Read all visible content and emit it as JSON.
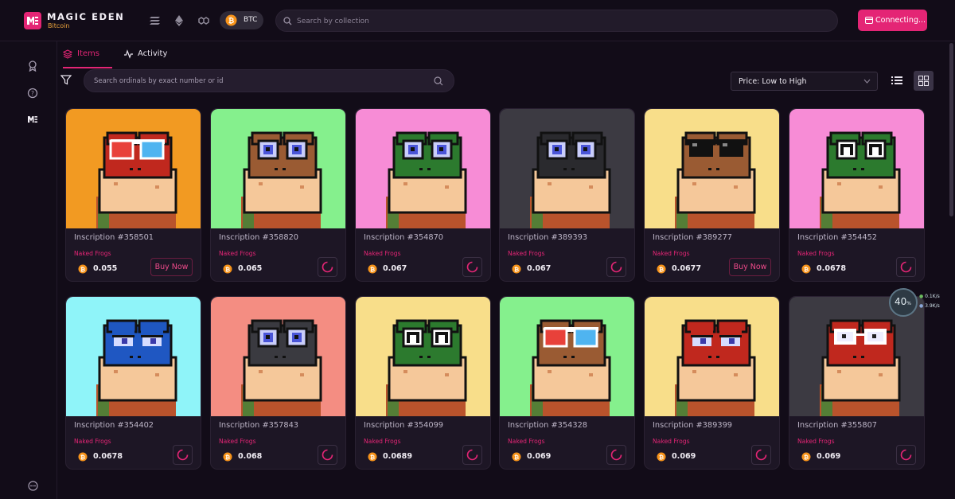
{
  "brand": {
    "name": "MAGIC EDEN",
    "sub": "Bitcoin"
  },
  "chain_pill": {
    "label": "BTC"
  },
  "top_search": {
    "placeholder": "Search by collection"
  },
  "connect_button": {
    "label": "Connecting..."
  },
  "tabs": [
    {
      "label": "Items"
    },
    {
      "label": "Activity"
    }
  ],
  "ordinal_search": {
    "placeholder": "Search ordinals by exact number or id"
  },
  "sort": {
    "selected": "Price: Low to High"
  },
  "colors": {
    "accent": "#e42575",
    "bg": "#120c18",
    "card": "#1d1625",
    "btc": "#f7931a"
  },
  "cards": [
    {
      "title": "Inscription #358501",
      "collection": "Naked Frogs",
      "price": "0.055",
      "action": "buy",
      "action_label": "Buy Now",
      "bg": "#f29a22",
      "skin": "#c0281e",
      "eyes": "3d-glasses"
    },
    {
      "title": "Inscription #358820",
      "collection": "Naked Frogs",
      "price": "0.065",
      "action": "loading",
      "bg": "#85f08d",
      "skin": "#9a5b33",
      "eyes": "normal"
    },
    {
      "title": "Inscription #354870",
      "collection": "Naked Frogs",
      "price": "0.067",
      "action": "loading",
      "bg": "#f78cd6",
      "skin": "#2c7a2e",
      "eyes": "normal"
    },
    {
      "title": "Inscription #389393",
      "collection": "Naked Frogs",
      "price": "0.067",
      "action": "loading",
      "bg": "#3c3a42",
      "skin": "#2a2a2e",
      "eyes": "normal"
    },
    {
      "title": "Inscription #389277",
      "collection": "Naked Frogs",
      "price": "0.0677",
      "action": "buy",
      "action_label": "Buy Now",
      "bg": "#f8de8a",
      "skin": "#9a5b33",
      "eyes": "shades"
    },
    {
      "title": "Inscription #354452",
      "collection": "Naked Frogs",
      "price": "0.0678",
      "action": "loading",
      "bg": "#f78cd6",
      "skin": "#2c7a2e",
      "eyes": "n"
    },
    {
      "title": "Inscription #354402",
      "collection": "Naked Frogs",
      "price": "0.0678",
      "action": "loading",
      "bg": "#8ff4f9",
      "skin": "#1f57c2",
      "eyes": "sleepy"
    },
    {
      "title": "Inscription #357843",
      "collection": "Naked Frogs",
      "price": "0.068",
      "action": "loading",
      "bg": "#f48d82",
      "skin": "#3a3a40",
      "eyes": "normal"
    },
    {
      "title": "Inscription #354099",
      "collection": "Naked Frogs",
      "price": "0.0689",
      "action": "loading",
      "bg": "#f8de8a",
      "skin": "#2c7a2e",
      "eyes": "n"
    },
    {
      "title": "Inscription #354328",
      "collection": "Naked Frogs",
      "price": "0.069",
      "action": "loading",
      "bg": "#85f08d",
      "skin": "#9a5b33",
      "eyes": "3d-glasses"
    },
    {
      "title": "Inscription #389399",
      "collection": "Naked Frogs",
      "price": "0.069",
      "action": "loading",
      "bg": "#f8de8a",
      "skin": "#c0281e",
      "eyes": "sleepy"
    },
    {
      "title": "Inscription #355807",
      "collection": "Naked Frogs",
      "price": "0.069",
      "action": "loading",
      "bg": "#3c3a42",
      "skin": "#c0281e",
      "eyes": "white-glasses"
    }
  ],
  "speed_widget": {
    "percent": "40",
    "percent_unit": "%",
    "up": "0.1",
    "up_unit": "K/s",
    "down": "3.9",
    "down_unit": "K/s"
  }
}
